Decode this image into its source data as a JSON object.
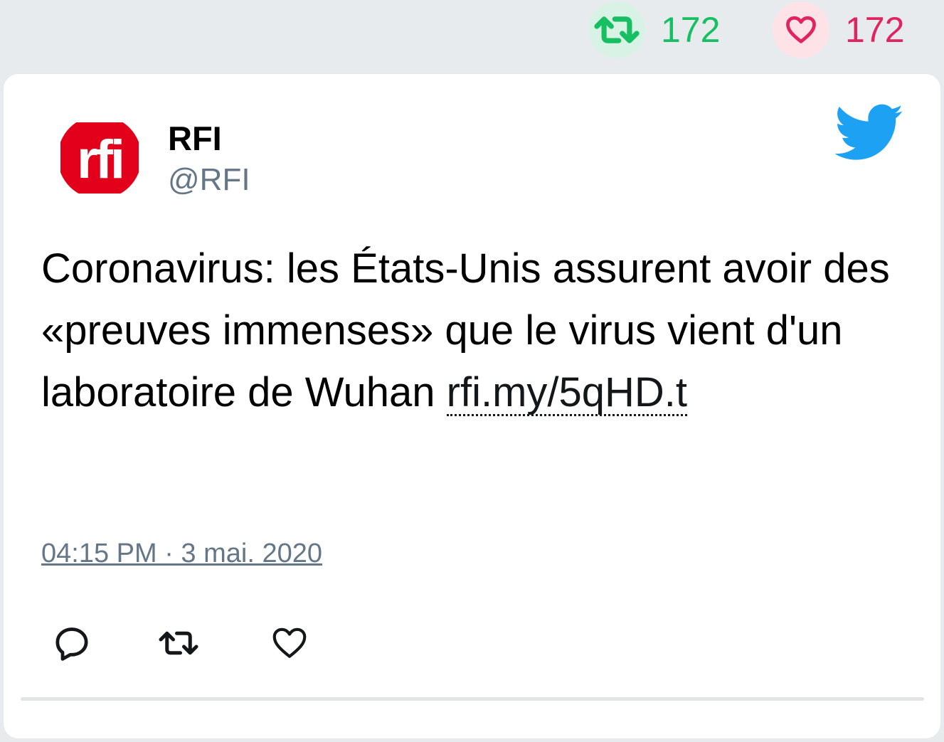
{
  "stats": {
    "retweet_count": "172",
    "like_count": "172"
  },
  "tweet": {
    "display_name": "RFI",
    "handle": "@RFI",
    "text": "Coronavirus: les États-Unis assurent avoir des «preuves immenses» que le virus vient d'un laboratoire de Wuhan ",
    "link": "rfi.my/5qHD.t",
    "timestamp": "04:15 PM · 3 mai. 2020",
    "avatar_logo_text": "rfi"
  },
  "icons": {
    "retweet": "retweet-icon",
    "like": "heart-icon",
    "reply": "reply-icon",
    "brand": "twitter-bird-icon"
  },
  "colors": {
    "retweet": "#17bf63",
    "like": "#e0245e",
    "twitter_blue": "#1da1f2",
    "rfi_red": "#e2001a",
    "muted": "#657786"
  }
}
